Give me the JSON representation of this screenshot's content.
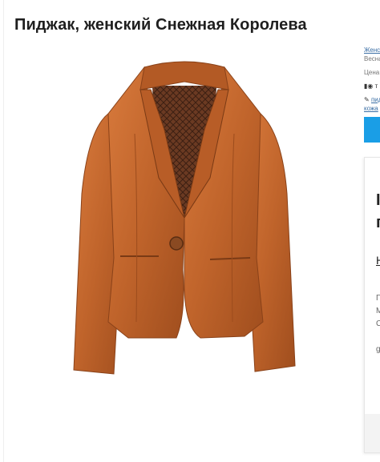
{
  "product": {
    "title": "Пиджак, женский Снежная Королева"
  },
  "sidebar": {
    "brand_link": "Женс",
    "season": "Весна",
    "price_label": "Цена:",
    "meta_icons": "▮◉ т",
    "tag_text": "пид",
    "tag_link": "кожа",
    "card": {
      "heading_line1": "I",
      "heading_line2": "п",
      "link_text": "Н",
      "text_line1": "Г",
      "text_line2": "М",
      "text_line3": "С",
      "text_line4": "g"
    }
  },
  "colors": {
    "accent_button": "#1a9ee6",
    "jacket": "#c0642b",
    "lining": "#6b3a22"
  }
}
